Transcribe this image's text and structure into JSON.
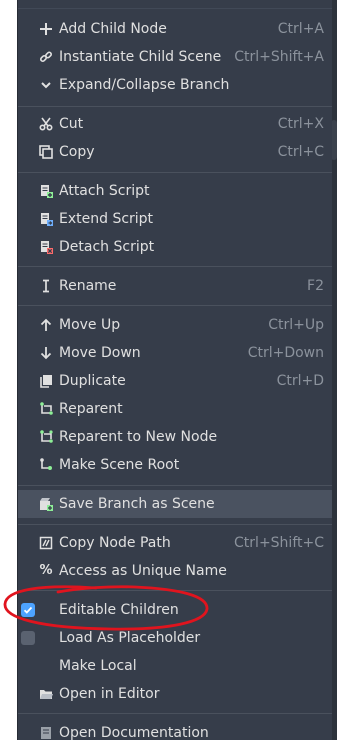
{
  "menu": {
    "items": [
      {
        "id": "add-child-node",
        "label": "Add Child Node",
        "shortcut": "Ctrl+A",
        "icon": "plus-icon"
      },
      {
        "id": "instantiate-child-scene",
        "label": "Instantiate Child Scene",
        "shortcut": "Ctrl+Shift+A",
        "icon": "link-icon"
      },
      {
        "id": "expand-collapse-branch",
        "label": "Expand/Collapse Branch",
        "shortcut": "",
        "icon": "chevron-down-icon"
      },
      {
        "id": "cut",
        "label": "Cut",
        "shortcut": "Ctrl+X",
        "icon": "scissors-icon"
      },
      {
        "id": "copy",
        "label": "Copy",
        "shortcut": "Ctrl+C",
        "icon": "copy-icon"
      },
      {
        "id": "attach-script",
        "label": "Attach Script",
        "shortcut": "",
        "icon": "script-add-icon"
      },
      {
        "id": "extend-script",
        "label": "Extend Script",
        "shortcut": "",
        "icon": "script-extend-icon"
      },
      {
        "id": "detach-script",
        "label": "Detach Script",
        "shortcut": "",
        "icon": "script-remove-icon"
      },
      {
        "id": "rename",
        "label": "Rename",
        "shortcut": "F2",
        "icon": "rename-icon"
      },
      {
        "id": "move-up",
        "label": "Move Up",
        "shortcut": "Ctrl+Up",
        "icon": "arrow-up-icon"
      },
      {
        "id": "move-down",
        "label": "Move Down",
        "shortcut": "Ctrl+Down",
        "icon": "arrow-down-icon"
      },
      {
        "id": "duplicate",
        "label": "Duplicate",
        "shortcut": "Ctrl+D",
        "icon": "duplicate-icon"
      },
      {
        "id": "reparent",
        "label": "Reparent",
        "shortcut": "",
        "icon": "reparent-icon"
      },
      {
        "id": "reparent-to-new-node",
        "label": "Reparent to New Node",
        "shortcut": "",
        "icon": "reparent-new-icon"
      },
      {
        "id": "make-scene-root",
        "label": "Make Scene Root",
        "shortcut": "",
        "icon": "scene-root-icon"
      },
      {
        "id": "save-branch-as-scene",
        "label": "Save Branch as Scene",
        "shortcut": "",
        "icon": "save-scene-icon"
      },
      {
        "id": "copy-node-path",
        "label": "Copy Node Path",
        "shortcut": "Ctrl+Shift+C",
        "icon": "copy-path-icon"
      },
      {
        "id": "access-as-unique-name",
        "label": "Access as Unique Name",
        "shortcut": "",
        "icon": "percent-icon"
      },
      {
        "id": "editable-children",
        "label": "Editable Children",
        "shortcut": "",
        "icon": "checkbox-checked-icon",
        "checked": true
      },
      {
        "id": "load-as-placeholder",
        "label": "Load As Placeholder",
        "shortcut": "",
        "icon": "checkbox-unchecked-icon",
        "checked": false
      },
      {
        "id": "make-local",
        "label": "Make Local",
        "shortcut": "",
        "icon": ""
      },
      {
        "id": "open-in-editor",
        "label": "Open in Editor",
        "shortcut": "",
        "icon": "folder-open-icon"
      },
      {
        "id": "open-documentation",
        "label": "Open Documentation",
        "shortcut": "",
        "icon": "doc-icon"
      }
    ],
    "hover_item": "save-branch-as-scene"
  },
  "colors": {
    "menu_bg": "#363d4a",
    "text": "#e0e0e0",
    "shortcut": "#8b929c",
    "hover": "#4a5260",
    "accent_check": "#4da3ff",
    "green_icon": "#8eef97",
    "annotation_red": "#e0141e"
  }
}
